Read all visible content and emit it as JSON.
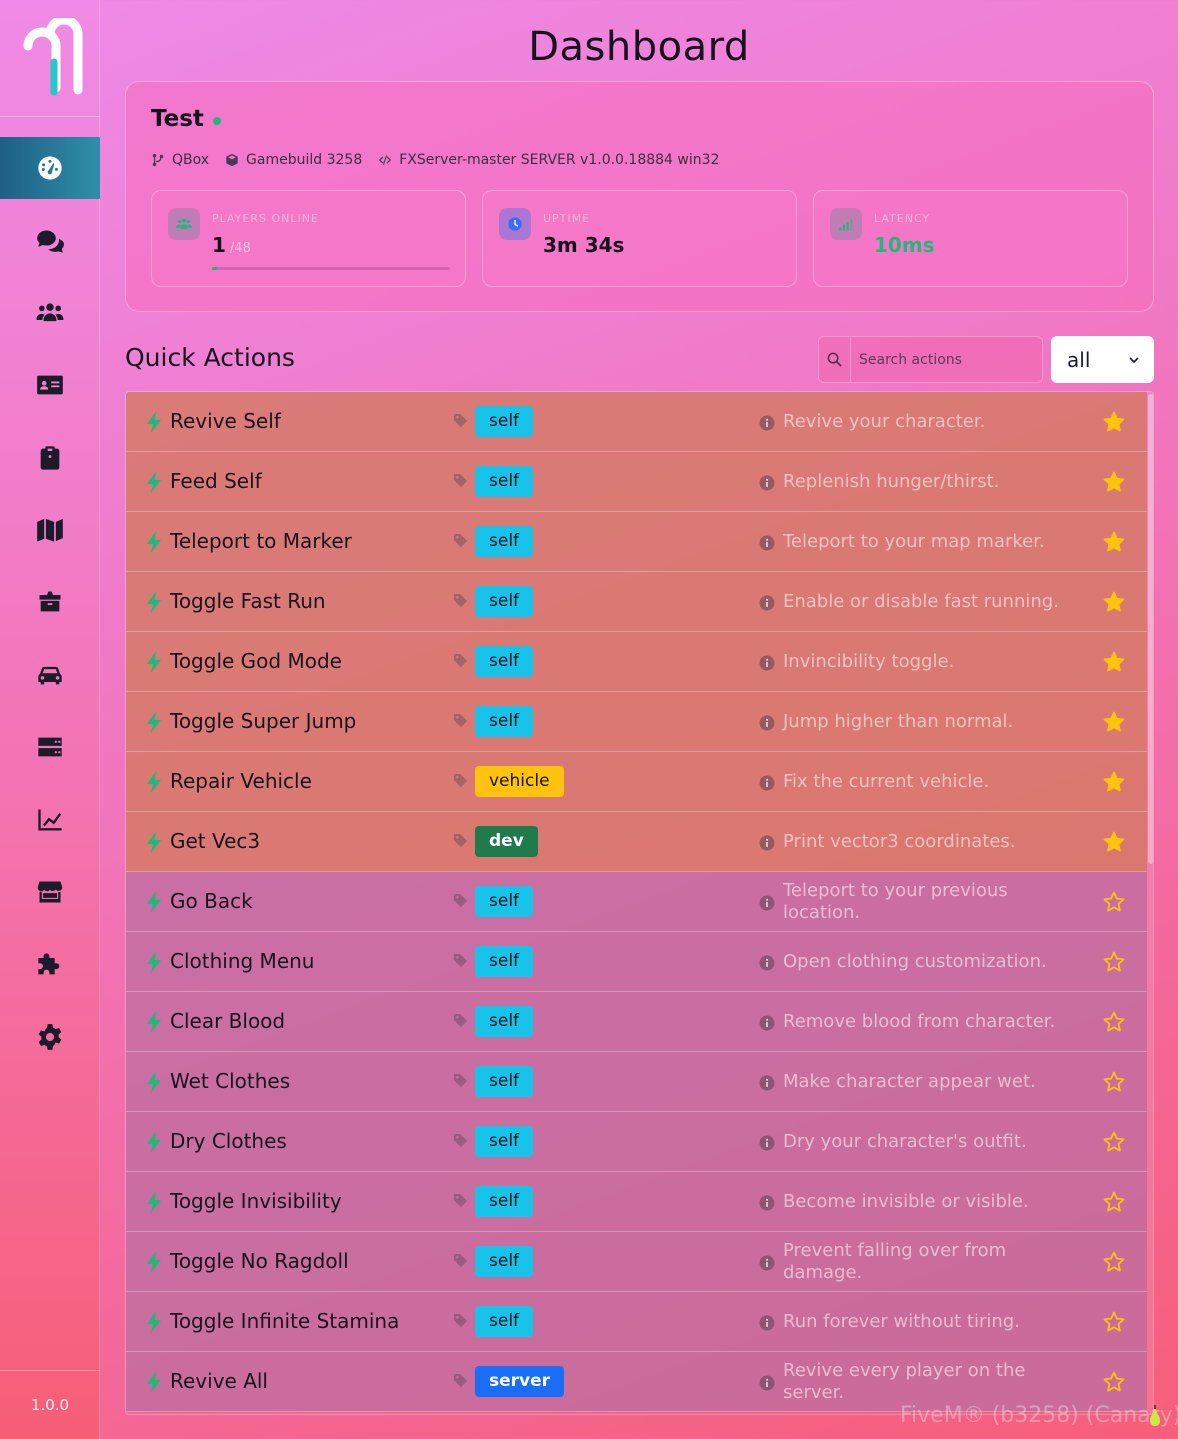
{
  "app": {
    "version": "1.0.0",
    "page_title": "Dashboard",
    "watermark": "FiveM® (b3258) (Canary)"
  },
  "sidebar": {
    "items": [
      {
        "icon": "dashboard-gauge-icon",
        "active": true
      },
      {
        "icon": "chat-icon",
        "active": false
      },
      {
        "icon": "players-icon",
        "active": false
      },
      {
        "icon": "id-card-icon",
        "active": false
      },
      {
        "icon": "clipboard-icon",
        "active": false
      },
      {
        "icon": "map-icon",
        "active": false
      },
      {
        "icon": "inventory-box-icon",
        "active": false
      },
      {
        "icon": "car-icon",
        "active": false
      },
      {
        "icon": "server-icon",
        "active": false
      },
      {
        "icon": "chart-line-icon",
        "active": false
      },
      {
        "icon": "store-icon",
        "active": false
      },
      {
        "icon": "puzzle-icon",
        "active": false
      },
      {
        "icon": "settings-gear-icon",
        "active": false
      }
    ]
  },
  "server": {
    "name": "Test",
    "status_color": "#1fb77a",
    "framework": "QBox",
    "gamebuild": "Gamebuild 3258",
    "version": "FXServer-master SERVER v1.0.0.18884 win32",
    "stats": {
      "players": {
        "label": "PLAYERS ONLINE",
        "value": "1",
        "max": "/48",
        "progress": 0.0208
      },
      "uptime": {
        "label": "UPTIME",
        "value": "3m 34s"
      },
      "latency": {
        "label": "LATENCY",
        "value": "10ms",
        "color": "#1fb77a"
      }
    }
  },
  "quick_actions": {
    "title": "Quick Actions",
    "search_placeholder": "Search actions",
    "filter_value": "all",
    "rows": [
      {
        "name": "Revive Self",
        "tag": "self",
        "desc": "Revive your character.",
        "fav": true
      },
      {
        "name": "Feed Self",
        "tag": "self",
        "desc": "Replenish hunger/thirst.",
        "fav": true
      },
      {
        "name": "Teleport to Marker",
        "tag": "self",
        "desc": "Teleport to your map marker.",
        "fav": true
      },
      {
        "name": "Toggle Fast Run",
        "tag": "self",
        "desc": "Enable or disable fast running.",
        "fav": true
      },
      {
        "name": "Toggle God Mode",
        "tag": "self",
        "desc": "Invincibility toggle.",
        "fav": true
      },
      {
        "name": "Toggle Super Jump",
        "tag": "self",
        "desc": "Jump higher than normal.",
        "fav": true
      },
      {
        "name": "Repair Vehicle",
        "tag": "vehicle",
        "desc": "Fix the current vehicle.",
        "fav": true
      },
      {
        "name": "Get Vec3",
        "tag": "dev",
        "desc": "Print vector3 coordinates.",
        "fav": true
      },
      {
        "name": "Go Back",
        "tag": "self",
        "desc": "Teleport to your previous location.",
        "fav": false
      },
      {
        "name": "Clothing Menu",
        "tag": "self",
        "desc": "Open clothing customization.",
        "fav": false
      },
      {
        "name": "Clear Blood",
        "tag": "self",
        "desc": "Remove blood from character.",
        "fav": false
      },
      {
        "name": "Wet Clothes",
        "tag": "self",
        "desc": "Make character appear wet.",
        "fav": false
      },
      {
        "name": "Dry Clothes",
        "tag": "self",
        "desc": "Dry your character's outfit.",
        "fav": false
      },
      {
        "name": "Toggle Invisibility",
        "tag": "self",
        "desc": "Become invisible or visible.",
        "fav": false
      },
      {
        "name": "Toggle No Ragdoll",
        "tag": "self",
        "desc": "Prevent falling over from damage.",
        "fav": false
      },
      {
        "name": "Toggle Infinite Stamina",
        "tag": "self",
        "desc": "Run forever without tiring.",
        "fav": false
      },
      {
        "name": "Revive All",
        "tag": "server",
        "desc": "Revive every player on the server.",
        "fav": false
      }
    ]
  },
  "colors": {
    "accent_green": "#1fb77a",
    "star": "#ffc20e",
    "badge_self": "#17c3e8",
    "badge_vehicle": "#ffc20e",
    "badge_dev": "#1f7a4c",
    "badge_server": "#1a6ef5"
  }
}
